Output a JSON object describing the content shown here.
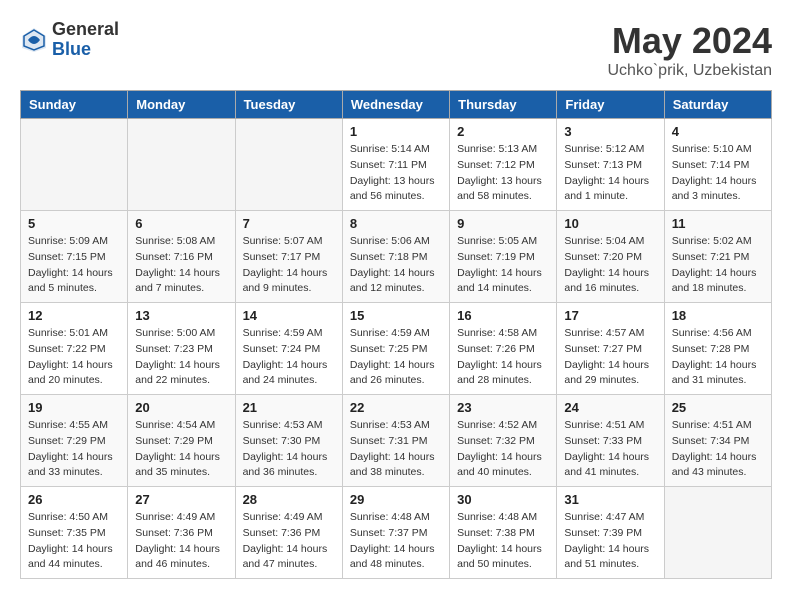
{
  "logo": {
    "general": "General",
    "blue": "Blue"
  },
  "title": "May 2024",
  "location": "Uchko`prik, Uzbekistan",
  "weekdays": [
    "Sunday",
    "Monday",
    "Tuesday",
    "Wednesday",
    "Thursday",
    "Friday",
    "Saturday"
  ],
  "weeks": [
    [
      {
        "day": "",
        "sunrise": "",
        "sunset": "",
        "daylight": ""
      },
      {
        "day": "",
        "sunrise": "",
        "sunset": "",
        "daylight": ""
      },
      {
        "day": "",
        "sunrise": "",
        "sunset": "",
        "daylight": ""
      },
      {
        "day": "1",
        "sunrise": "Sunrise: 5:14 AM",
        "sunset": "Sunset: 7:11 PM",
        "daylight": "Daylight: 13 hours and 56 minutes."
      },
      {
        "day": "2",
        "sunrise": "Sunrise: 5:13 AM",
        "sunset": "Sunset: 7:12 PM",
        "daylight": "Daylight: 13 hours and 58 minutes."
      },
      {
        "day": "3",
        "sunrise": "Sunrise: 5:12 AM",
        "sunset": "Sunset: 7:13 PM",
        "daylight": "Daylight: 14 hours and 1 minute."
      },
      {
        "day": "4",
        "sunrise": "Sunrise: 5:10 AM",
        "sunset": "Sunset: 7:14 PM",
        "daylight": "Daylight: 14 hours and 3 minutes."
      }
    ],
    [
      {
        "day": "5",
        "sunrise": "Sunrise: 5:09 AM",
        "sunset": "Sunset: 7:15 PM",
        "daylight": "Daylight: 14 hours and 5 minutes."
      },
      {
        "day": "6",
        "sunrise": "Sunrise: 5:08 AM",
        "sunset": "Sunset: 7:16 PM",
        "daylight": "Daylight: 14 hours and 7 minutes."
      },
      {
        "day": "7",
        "sunrise": "Sunrise: 5:07 AM",
        "sunset": "Sunset: 7:17 PM",
        "daylight": "Daylight: 14 hours and 9 minutes."
      },
      {
        "day": "8",
        "sunrise": "Sunrise: 5:06 AM",
        "sunset": "Sunset: 7:18 PM",
        "daylight": "Daylight: 14 hours and 12 minutes."
      },
      {
        "day": "9",
        "sunrise": "Sunrise: 5:05 AM",
        "sunset": "Sunset: 7:19 PM",
        "daylight": "Daylight: 14 hours and 14 minutes."
      },
      {
        "day": "10",
        "sunrise": "Sunrise: 5:04 AM",
        "sunset": "Sunset: 7:20 PM",
        "daylight": "Daylight: 14 hours and 16 minutes."
      },
      {
        "day": "11",
        "sunrise": "Sunrise: 5:02 AM",
        "sunset": "Sunset: 7:21 PM",
        "daylight": "Daylight: 14 hours and 18 minutes."
      }
    ],
    [
      {
        "day": "12",
        "sunrise": "Sunrise: 5:01 AM",
        "sunset": "Sunset: 7:22 PM",
        "daylight": "Daylight: 14 hours and 20 minutes."
      },
      {
        "day": "13",
        "sunrise": "Sunrise: 5:00 AM",
        "sunset": "Sunset: 7:23 PM",
        "daylight": "Daylight: 14 hours and 22 minutes."
      },
      {
        "day": "14",
        "sunrise": "Sunrise: 4:59 AM",
        "sunset": "Sunset: 7:24 PM",
        "daylight": "Daylight: 14 hours and 24 minutes."
      },
      {
        "day": "15",
        "sunrise": "Sunrise: 4:59 AM",
        "sunset": "Sunset: 7:25 PM",
        "daylight": "Daylight: 14 hours and 26 minutes."
      },
      {
        "day": "16",
        "sunrise": "Sunrise: 4:58 AM",
        "sunset": "Sunset: 7:26 PM",
        "daylight": "Daylight: 14 hours and 28 minutes."
      },
      {
        "day": "17",
        "sunrise": "Sunrise: 4:57 AM",
        "sunset": "Sunset: 7:27 PM",
        "daylight": "Daylight: 14 hours and 29 minutes."
      },
      {
        "day": "18",
        "sunrise": "Sunrise: 4:56 AM",
        "sunset": "Sunset: 7:28 PM",
        "daylight": "Daylight: 14 hours and 31 minutes."
      }
    ],
    [
      {
        "day": "19",
        "sunrise": "Sunrise: 4:55 AM",
        "sunset": "Sunset: 7:29 PM",
        "daylight": "Daylight: 14 hours and 33 minutes."
      },
      {
        "day": "20",
        "sunrise": "Sunrise: 4:54 AM",
        "sunset": "Sunset: 7:29 PM",
        "daylight": "Daylight: 14 hours and 35 minutes."
      },
      {
        "day": "21",
        "sunrise": "Sunrise: 4:53 AM",
        "sunset": "Sunset: 7:30 PM",
        "daylight": "Daylight: 14 hours and 36 minutes."
      },
      {
        "day": "22",
        "sunrise": "Sunrise: 4:53 AM",
        "sunset": "Sunset: 7:31 PM",
        "daylight": "Daylight: 14 hours and 38 minutes."
      },
      {
        "day": "23",
        "sunrise": "Sunrise: 4:52 AM",
        "sunset": "Sunset: 7:32 PM",
        "daylight": "Daylight: 14 hours and 40 minutes."
      },
      {
        "day": "24",
        "sunrise": "Sunrise: 4:51 AM",
        "sunset": "Sunset: 7:33 PM",
        "daylight": "Daylight: 14 hours and 41 minutes."
      },
      {
        "day": "25",
        "sunrise": "Sunrise: 4:51 AM",
        "sunset": "Sunset: 7:34 PM",
        "daylight": "Daylight: 14 hours and 43 minutes."
      }
    ],
    [
      {
        "day": "26",
        "sunrise": "Sunrise: 4:50 AM",
        "sunset": "Sunset: 7:35 PM",
        "daylight": "Daylight: 14 hours and 44 minutes."
      },
      {
        "day": "27",
        "sunrise": "Sunrise: 4:49 AM",
        "sunset": "Sunset: 7:36 PM",
        "daylight": "Daylight: 14 hours and 46 minutes."
      },
      {
        "day": "28",
        "sunrise": "Sunrise: 4:49 AM",
        "sunset": "Sunset: 7:36 PM",
        "daylight": "Daylight: 14 hours and 47 minutes."
      },
      {
        "day": "29",
        "sunrise": "Sunrise: 4:48 AM",
        "sunset": "Sunset: 7:37 PM",
        "daylight": "Daylight: 14 hours and 48 minutes."
      },
      {
        "day": "30",
        "sunrise": "Sunrise: 4:48 AM",
        "sunset": "Sunset: 7:38 PM",
        "daylight": "Daylight: 14 hours and 50 minutes."
      },
      {
        "day": "31",
        "sunrise": "Sunrise: 4:47 AM",
        "sunset": "Sunset: 7:39 PM",
        "daylight": "Daylight: 14 hours and 51 minutes."
      },
      {
        "day": "",
        "sunrise": "",
        "sunset": "",
        "daylight": ""
      }
    ]
  ]
}
